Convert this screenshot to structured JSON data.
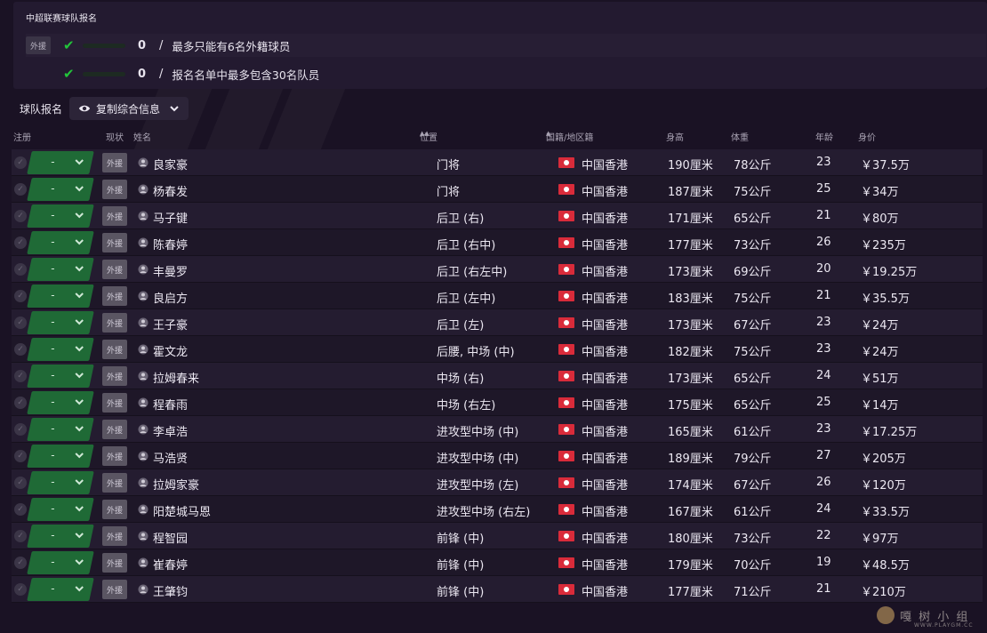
{
  "quota_panel": {
    "title": "中超联赛球队报名",
    "foreign_tag": "外援",
    "rows": [
      {
        "count": "0",
        "slash": "/",
        "text": "最多只能有6名外籍球员"
      },
      {
        "count": "0",
        "slash": "/",
        "text": "报名名单中最多包含30名队员"
      }
    ]
  },
  "toolbar": {
    "label": "球队报名",
    "copy_button": "复制综合信息"
  },
  "columns": {
    "register": "注册",
    "status": "现状",
    "name": "姓名",
    "position": "位置",
    "nationality": "国籍/地区籍",
    "height": "身高",
    "weight": "体重",
    "age": "年龄",
    "value": "身价"
  },
  "players": [
    {
      "status": "-",
      "tag": "外援",
      "name": "良家豪",
      "position": "门将",
      "nation": "中国香港",
      "height": "190厘米",
      "weight": "78公斤",
      "age": "23",
      "value": "￥37.5万"
    },
    {
      "status": "-",
      "tag": "外援",
      "name": "杨春发",
      "position": "门将",
      "nation": "中国香港",
      "height": "187厘米",
      "weight": "75公斤",
      "age": "25",
      "value": "￥34万"
    },
    {
      "status": "-",
      "tag": "外援",
      "name": "马子键",
      "position": "后卫 (右)",
      "nation": "中国香港",
      "height": "171厘米",
      "weight": "65公斤",
      "age": "21",
      "value": "￥80万"
    },
    {
      "status": "-",
      "tag": "外援",
      "name": "陈春婷",
      "position": "后卫 (右中)",
      "nation": "中国香港",
      "height": "177厘米",
      "weight": "73公斤",
      "age": "26",
      "value": "￥235万"
    },
    {
      "status": "-",
      "tag": "外援",
      "name": "丰曼罗",
      "position": "后卫 (右左中)",
      "nation": "中国香港",
      "height": "173厘米",
      "weight": "69公斤",
      "age": "20",
      "value": "￥19.25万"
    },
    {
      "status": "-",
      "tag": "外援",
      "name": "良启方",
      "position": "后卫 (左中)",
      "nation": "中国香港",
      "height": "183厘米",
      "weight": "75公斤",
      "age": "21",
      "value": "￥35.5万"
    },
    {
      "status": "-",
      "tag": "外援",
      "name": "王子豪",
      "position": "后卫 (左)",
      "nation": "中国香港",
      "height": "173厘米",
      "weight": "67公斤",
      "age": "23",
      "value": "￥24万"
    },
    {
      "status": "-",
      "tag": "外援",
      "name": "霍文龙",
      "position": "后腰, 中场 (中)",
      "nation": "中国香港",
      "height": "182厘米",
      "weight": "75公斤",
      "age": "23",
      "value": "￥24万"
    },
    {
      "status": "-",
      "tag": "外援",
      "name": "拉姆春来",
      "position": "中场 (右)",
      "nation": "中国香港",
      "height": "173厘米",
      "weight": "65公斤",
      "age": "24",
      "value": "￥51万"
    },
    {
      "status": "-",
      "tag": "外援",
      "name": "程春雨",
      "position": "中场 (右左)",
      "nation": "中国香港",
      "height": "175厘米",
      "weight": "65公斤",
      "age": "25",
      "value": "￥14万"
    },
    {
      "status": "-",
      "tag": "外援",
      "name": "李卓浩",
      "position": "进攻型中场 (中)",
      "nation": "中国香港",
      "height": "165厘米",
      "weight": "61公斤",
      "age": "23",
      "value": "￥17.25万"
    },
    {
      "status": "-",
      "tag": "外援",
      "name": "马浩贤",
      "position": "进攻型中场 (中)",
      "nation": "中国香港",
      "height": "189厘米",
      "weight": "79公斤",
      "age": "27",
      "value": "￥205万"
    },
    {
      "status": "-",
      "tag": "外援",
      "name": "拉姆家豪",
      "position": "进攻型中场 (左)",
      "nation": "中国香港",
      "height": "174厘米",
      "weight": "67公斤",
      "age": "26",
      "value": "￥120万"
    },
    {
      "status": "-",
      "tag": "外援",
      "name": "阳楚城马恩",
      "position": "进攻型中场 (右左)",
      "nation": "中国香港",
      "height": "167厘米",
      "weight": "61公斤",
      "age": "24",
      "value": "￥33.5万"
    },
    {
      "status": "-",
      "tag": "外援",
      "name": "程智园",
      "position": "前锋 (中)",
      "nation": "中国香港",
      "height": "180厘米",
      "weight": "73公斤",
      "age": "22",
      "value": "￥97万"
    },
    {
      "status": "-",
      "tag": "外援",
      "name": "崔春婷",
      "position": "前锋 (中)",
      "nation": "中国香港",
      "height": "179厘米",
      "weight": "70公斤",
      "age": "19",
      "value": "￥48.5万"
    },
    {
      "status": "-",
      "tag": "外援",
      "name": "王肇钧",
      "position": "前锋 (中)",
      "nation": "中国香港",
      "height": "177厘米",
      "weight": "71公斤",
      "age": "21",
      "value": "￥210万"
    }
  ],
  "watermark": {
    "text": "嘎 树 小 组",
    "sub": "WWW.PLAYGM.CC"
  },
  "colors": {
    "accent_green": "#1f6a36",
    "check_green": "#22c43a",
    "flag_red": "#d92b3a",
    "background": "#1a1224"
  }
}
